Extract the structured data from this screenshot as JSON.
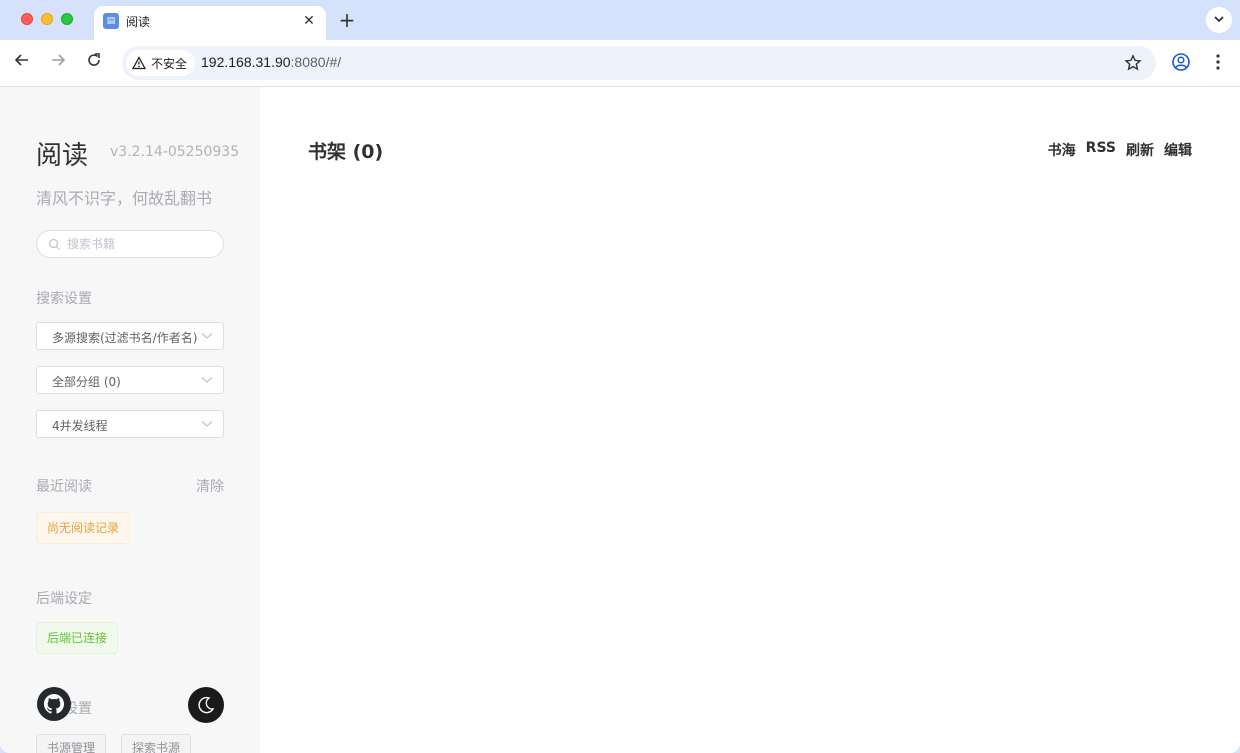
{
  "browser": {
    "tab_title": "阅读",
    "security_label": "不安全",
    "url_host": "192.168.31.90",
    "url_rest": ":8080/#/"
  },
  "sidebar": {
    "app_title": "阅读",
    "version": "v3.2.14-05250935",
    "slogan": "清风不识字，何故乱翻书",
    "search_placeholder": "搜索书籍",
    "search_settings_label": "搜索设置",
    "search_mode": "多源搜索(过滤书名/作者名)",
    "group": "全部分组 (0)",
    "threads": "4并发线程",
    "recent_label": "最近阅读",
    "recent_clear": "清除",
    "recent_empty": "尚无阅读记录",
    "backend_label": "后端设定",
    "backend_status": "后端已连接",
    "source_label": "书源设置",
    "source_manage": "书源管理",
    "source_explore": "探索书源"
  },
  "main": {
    "shelf_title": "书架 (0)",
    "actions": [
      "书海",
      "RSS",
      "刷新",
      "编辑"
    ]
  },
  "colors": {
    "accent_warning": "#e6a23c",
    "accent_success": "#67c23a"
  }
}
